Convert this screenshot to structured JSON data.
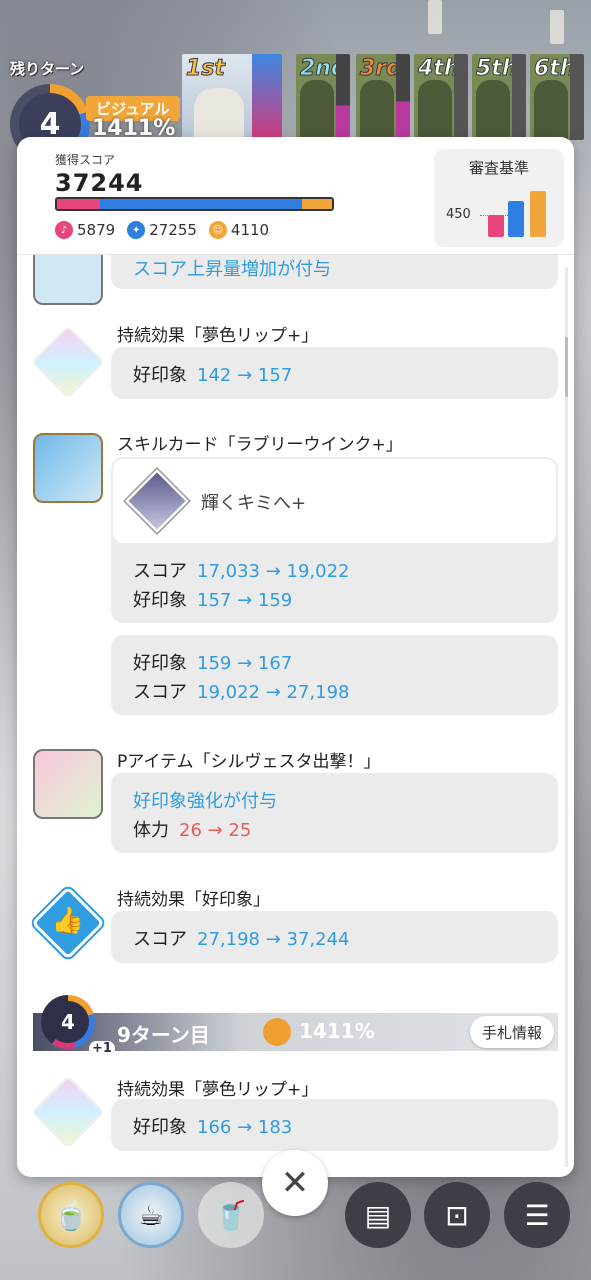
{
  "hud": {
    "turns_label": "残りターン",
    "turns_remaining": "4",
    "visual_label": "ビジュアル",
    "visual_percent": "1411%",
    "ranks": [
      "1st",
      "2nd",
      "3rd",
      "4th",
      "5th",
      "6th"
    ]
  },
  "score": {
    "label": "獲得スコア",
    "total": "37244",
    "vocal": "5879",
    "dance": "27255",
    "visual": "4110",
    "bar_fractions": [
      0.158,
      0.732,
      0.11
    ],
    "criteria_title": "審査基準",
    "criteria_value": "450"
  },
  "log": {
    "partial_top_text": "スコア上昇量増加が付与",
    "e1": {
      "title": "持続効果「夢色リップ+」",
      "label": "好印象",
      "value": "142 → 157"
    },
    "e2": {
      "title": "スキルカード「ラブリーウインク+」",
      "card_name": "輝くキミへ+",
      "r1_label": "スコア",
      "r1_value": "17,033 → 19,022",
      "r2_label": "好印象",
      "r2_value": "157 → 159",
      "r3_label": "好印象",
      "r3_value": "159 → 167",
      "r4_label": "スコア",
      "r4_value": "19,022 → 27,198"
    },
    "e3": {
      "title": "Pアイテム「シルヴェスタ出撃！」",
      "effect": "好印象強化が付与",
      "hp_label": "体力",
      "hp_value": "26 → 25"
    },
    "e4": {
      "title": "持続効果「好印象」",
      "label": "スコア",
      "value": "27,198 → 37,244"
    },
    "turn": {
      "number": "4",
      "plus": "+1",
      "label": "9ターン目",
      "percent": "1411%",
      "hand_button": "手札情報"
    },
    "e5": {
      "title": "持続効果「夢色リップ+」",
      "label": "好印象",
      "value": "166 → 183"
    }
  },
  "bottom": {
    "close_symbol": "✕"
  },
  "colors": {
    "vocal": "#e8457e",
    "dance": "#2f7fe0",
    "visual": "#f2a53a",
    "value_blue": "#2f9de0",
    "value_red": "#ea5b5b"
  }
}
